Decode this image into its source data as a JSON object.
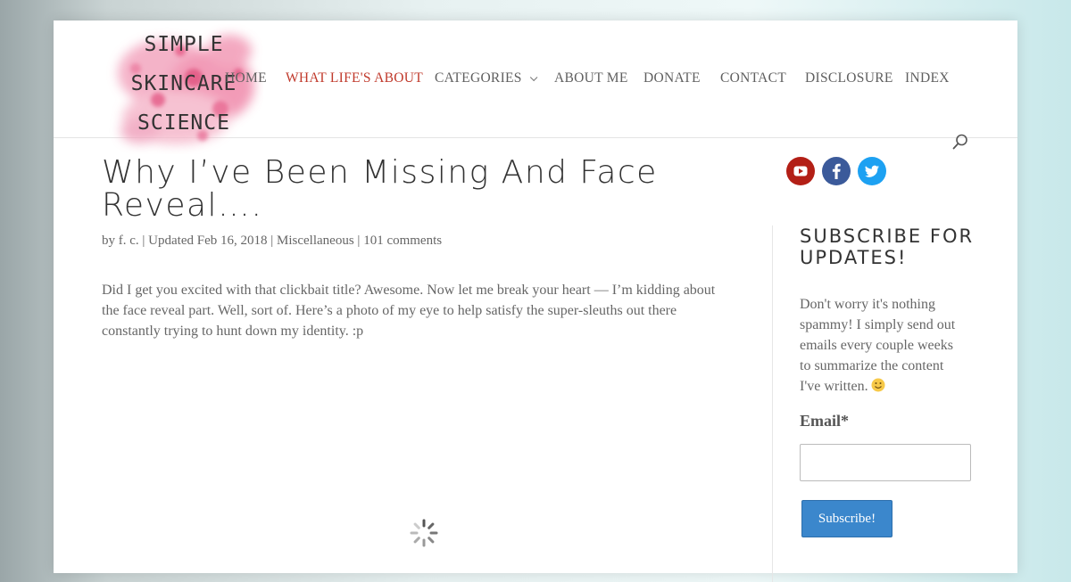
{
  "site": {
    "logo_lines": [
      "SIMPLE",
      "SKINCARE",
      "SCIENCE"
    ]
  },
  "nav": {
    "items": [
      {
        "label": "HOME"
      },
      {
        "label": "WHAT LIFE'S ABOUT"
      },
      {
        "label": "CATEGORIES"
      },
      {
        "label": "ABOUT ME"
      },
      {
        "label": "DONATE"
      },
      {
        "label": "CONTACT"
      },
      {
        "label": "DISCLOSURE"
      },
      {
        "label": "INDEX"
      }
    ],
    "active_color": "#c0392b",
    "search_icon": "search-icon"
  },
  "post": {
    "title": "Why I’ve Been Missing And Face Reveal….",
    "meta": {
      "by": "by f. c.",
      "sep": "|",
      "updated": "Updated Feb 16, 2018",
      "category": "Miscellaneous",
      "comments": "101 comments"
    },
    "excerpt": "Did I get you excited with that clickbait title? Awesome. Now let me break your heart — I’m kidding about the face reveal part. Well, sort of. Here’s a photo of my eye to help satisfy the super-sleuths out there constantly trying to hunt down my identity. :p"
  },
  "social": [
    {
      "icon": "youtube-icon",
      "color": "#b31f16"
    },
    {
      "icon": "facebook-icon",
      "color": "#3b5a9a"
    },
    {
      "icon": "twitter-icon",
      "color": "#1da1f2"
    }
  ],
  "sidebar": {
    "title": "SUBSCRIBE FOR UPDATES!",
    "text": "Don't worry it's nothing spammy! I simply send out emails every couple weeks to summarize the content I've written.",
    "email_label": "Email*",
    "email_value": "",
    "button_label": "Subscribe!",
    "button_color": "#3b87cc"
  }
}
